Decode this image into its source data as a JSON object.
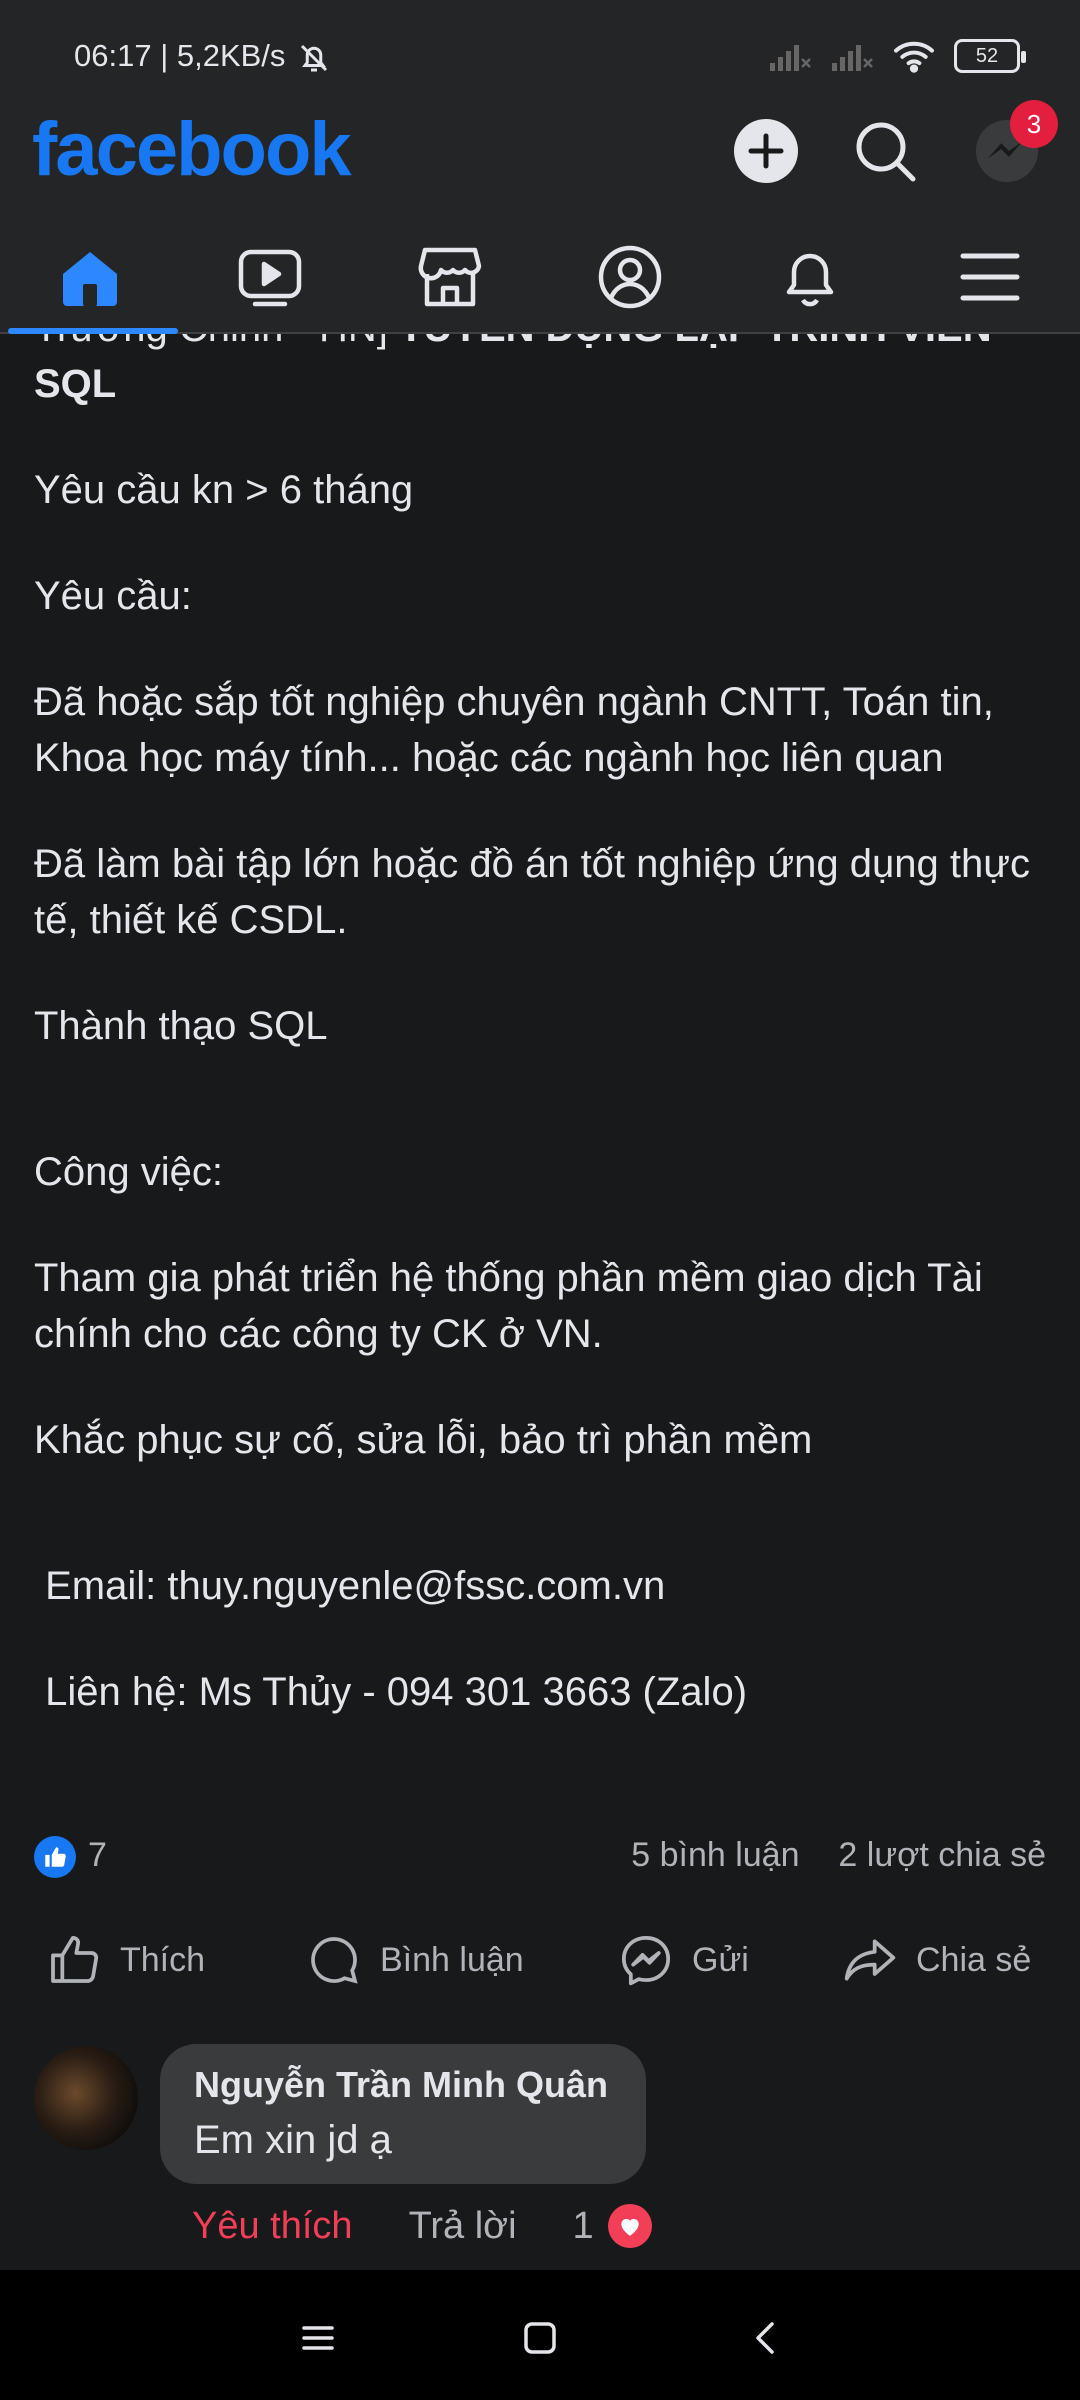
{
  "status_bar": {
    "time_speed": "06:17 | 5,2KB/s",
    "battery": "52",
    "icons": [
      "bell-off-icon",
      "signal-off-icon",
      "signal-off-icon",
      "wifi-icon",
      "battery-icon"
    ]
  },
  "header": {
    "logo": "facebook",
    "messenger_badge": "3",
    "icons": [
      "add-icon",
      "search-icon",
      "messenger-icon"
    ]
  },
  "nav": {
    "tabs": [
      "home-icon",
      "video-icon",
      "marketplace-icon",
      "profile-icon",
      "notifications-icon",
      "menu-icon"
    ],
    "active": "home-icon"
  },
  "post": {
    "intro_normal": "Trường Chinh - HN] ",
    "intro_bold": "TUYỂN DỤNG LẬP TRÌNH VIÊN SQL",
    "lines": [
      "Yêu cầu kn > 6 tháng",
      "Yêu cầu:",
      "Đã hoặc sắp tốt nghiệp chuyên ngành CNTT, Toán tin, Khoa học máy tính... hoặc các ngành học liên quan",
      "Đã làm bài tập lớn hoặc đồ án tốt nghiệp ứng dụng thực tế, thiết kế CSDL.",
      "Thành thạo SQL",
      "Công việc:",
      "Tham gia phát triển hệ thống phần mềm giao dịch Tài chính cho các công ty CK ở VN.",
      "Khắc phục sự cố, sửa lỗi, bảo trì phần mềm",
      " Email: thuy.nguyenle@fssc.com.vn",
      " Liên hệ: Ms Thủy - 094 301 3663 (Zalo)"
    ]
  },
  "reactions": {
    "like_count": "7",
    "comments": "5 bình luận",
    "shares": "2 lượt chia sẻ"
  },
  "actions": {
    "like": "Thích",
    "comment": "Bình luận",
    "send": "Gửi",
    "share": "Chia sẻ"
  },
  "comment": {
    "author": "Nguyễn Trần Minh Quân",
    "text": "Em xin jd ạ",
    "like_label": "Yêu thích",
    "reply_label": "Trả lời",
    "reaction_count": "1"
  },
  "colors": {
    "background": "#18191a",
    "bar": "#242526",
    "accent": "#1877f2",
    "like_red": "#f33e58"
  }
}
